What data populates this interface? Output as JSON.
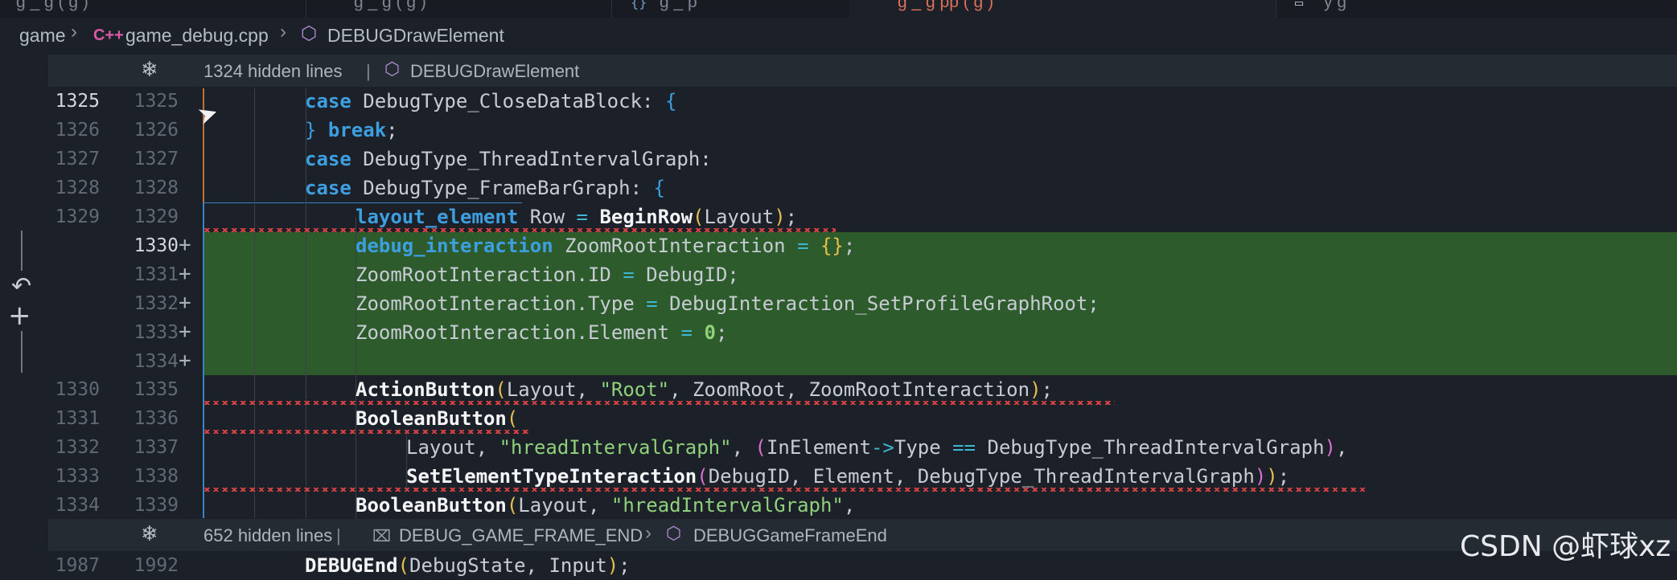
{
  "tabs": [
    {
      "label": "g  _ g  (  g  )  "
    },
    {
      "label": "g  _ g  (  g  )  "
    },
    {
      "label": "g  _ p"
    },
    {
      "label": "g  _  g  pp (  g  )  "
    },
    {
      "label": "y  g"
    }
  ],
  "breadcrumb": {
    "folder": "game",
    "lang_icon": "C++",
    "file": "game_debug.cpp",
    "symbol": "DEBUGDrawElement"
  },
  "fold_top": {
    "hidden": "1324 hidden lines",
    "separator": "|",
    "symbol": "DEBUGDrawElement"
  },
  "fold_bottom": {
    "hidden": "652 hidden lines",
    "separator": "|",
    "macro": "DEBUG_GAME_FRAME_END",
    "symbol": "DEBUGGameFrameEnd"
  },
  "lines": [
    {
      "old": "1325",
      "new": "1325"
    },
    {
      "old": "1326",
      "new": "1326"
    },
    {
      "old": "1327",
      "new": "1327"
    },
    {
      "old": "1328",
      "new": "1328"
    },
    {
      "old": "1329",
      "new": "1329"
    },
    {
      "old": "",
      "new": "1330",
      "add": "+"
    },
    {
      "old": "",
      "new": "1331",
      "add": "+"
    },
    {
      "old": "",
      "new": "1332",
      "add": "+"
    },
    {
      "old": "",
      "new": "1333",
      "add": "+"
    },
    {
      "old": "",
      "new": "1334",
      "add": "+"
    },
    {
      "old": "1330",
      "new": "1335"
    },
    {
      "old": "1331",
      "new": "1336"
    },
    {
      "old": "1332",
      "new": "1337"
    },
    {
      "old": "1333",
      "new": "1338"
    },
    {
      "old": "1334",
      "new": "1339"
    },
    {
      "old": "1987",
      "new": "1992"
    }
  ],
  "code": {
    "l1325": [
      "case",
      " DebugType_CloseDataBlock: ",
      "{"
    ],
    "l1326": [
      "}",
      " ",
      "break",
      ";"
    ],
    "l1327": [
      "case",
      " DebugType_ThreadIntervalGraph:"
    ],
    "l1328": [
      "case",
      " DebugType_FrameBarGraph: ",
      "{"
    ],
    "l1329": [
      "layout_element",
      " Row ",
      "=",
      " ",
      "BeginRow",
      "(",
      "Layout",
      ")",
      ";"
    ],
    "l1330": [
      "debug_interaction",
      " ZoomRootInteraction ",
      "=",
      " ",
      "{}",
      ";"
    ],
    "l1331": [
      "ZoomRootInteraction.ID ",
      "=",
      " DebugID;"
    ],
    "l1332": [
      "ZoomRootInteraction.Type ",
      "=",
      " DebugInteraction_SetProfileGraphRoot;"
    ],
    "l1333": [
      "ZoomRootInteraction.Element ",
      "=",
      " ",
      "0",
      ";"
    ],
    "l1335": [
      "ActionButton",
      "(",
      "Layout, ",
      "\"Root\"",
      ", ZoomRoot, ZoomRootInteraction",
      ")",
      ";"
    ],
    "l1336": [
      "BooleanButton",
      "("
    ],
    "l1337": [
      "Layout, ",
      "\"hreadIntervalGraph\"",
      ", ",
      "(",
      "InElement",
      "->",
      "Type ",
      "==",
      " DebugType_ThreadIntervalGraph",
      ")",
      ","
    ],
    "l1338": [
      "SetElementTypeInteraction",
      "(",
      "DebugID, Element, DebugType_ThreadIntervalGraph",
      ")",
      ")",
      ";"
    ],
    "l1339": [
      "BooleanButton",
      "(",
      "Layout, ",
      "\"hreadIntervalGraph\"",
      ","
    ],
    "l1992": [
      "DEBUGEnd",
      "(",
      "DebugState, Input",
      ")",
      ";"
    ]
  },
  "gutter_icons": {
    "revert": "revert-icon",
    "add": "add-icon",
    "fold": "snowflake-icon"
  },
  "watermark": "CSDN @虾球xz",
  "colors": {
    "insert_bg": "#2d5b2b",
    "keyword": "#3d9fe0",
    "string": "#8fd17a",
    "operator": "#3fb7d4"
  }
}
